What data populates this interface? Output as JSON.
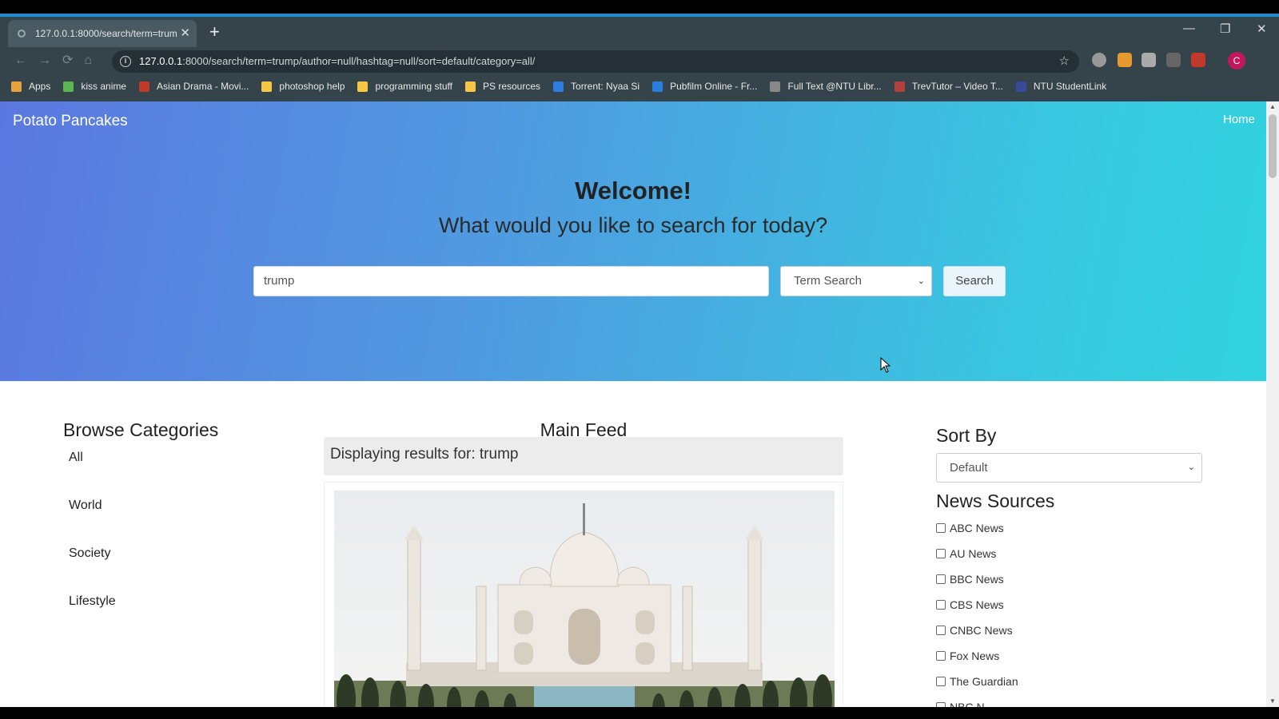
{
  "browser": {
    "tab_title": "127.0.0.1:8000/search/term=trum",
    "url_host": "127.0.0.1",
    "url_rest": ":8000/search/term=trump/author=null/hashtag=null/sort=default/category=all/",
    "profile_initial": "C",
    "bookmarks": [
      {
        "label": "Apps",
        "color": "#e8a33d"
      },
      {
        "label": "kiss anime",
        "color": "#5ab552"
      },
      {
        "label": "Asian Drama - Movi...",
        "color": "#c0392b"
      },
      {
        "label": "photoshop help",
        "color": "#f6c744"
      },
      {
        "label": "programming stuff",
        "color": "#f6c744"
      },
      {
        "label": "PS resources",
        "color": "#f6c744"
      },
      {
        "label": "Torrent: Nyaa Si",
        "color": "#2f7de1"
      },
      {
        "label": "Pubfilm Online - Fr...",
        "color": "#2a7de1"
      },
      {
        "label": "Full Text @NTU Libr...",
        "color": "#888888"
      },
      {
        "label": "TrevTutor – Video T...",
        "color": "#b0413e"
      },
      {
        "label": "NTU StudentLink",
        "color": "#3a4a9a"
      }
    ]
  },
  "page": {
    "brand": "Potato Pancakes",
    "nav_home": "Home",
    "welcome": "Welcome!",
    "subtitle": "What would you like to search for today?",
    "search_value": "trump",
    "search_type": "Term Search",
    "search_button": "Search",
    "categories_heading": "Browse Categories",
    "categories": [
      "All",
      "World",
      "Society",
      "Lifestyle"
    ],
    "feed_heading": "Main Feed",
    "results_text": "Displaying results for: trump",
    "sort_heading": "Sort By",
    "sort_value": "Default",
    "sources_heading": "News Sources",
    "sources": [
      "ABC News",
      "AU News",
      "BBC News",
      "CBS News",
      "CNBC News",
      "Fox News",
      "The Guardian",
      "NBC N..."
    ]
  },
  "colors": {
    "hero_start": "#5b78e0",
    "hero_end": "#30d3df",
    "chrome": "#35434b"
  }
}
